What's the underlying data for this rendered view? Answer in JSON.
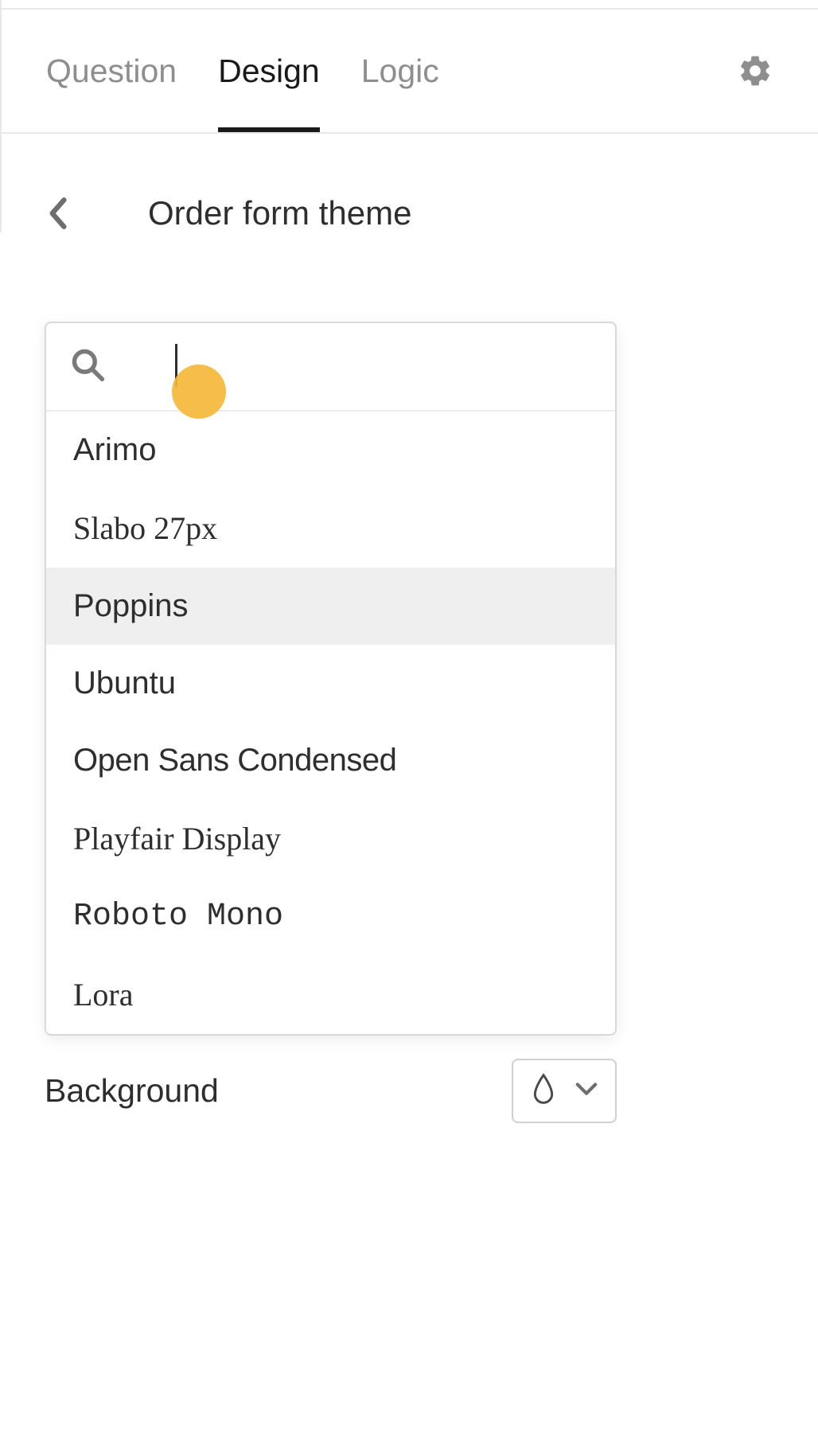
{
  "tabs": [
    {
      "label": "Question",
      "active": false
    },
    {
      "label": "Design",
      "active": true
    },
    {
      "label": "Logic",
      "active": false
    }
  ],
  "theme": {
    "title": "Order form theme"
  },
  "search": {
    "placeholder": ""
  },
  "fonts": [
    {
      "label": "Arimo",
      "class": "font-arimo",
      "selected": false
    },
    {
      "label": "Slabo 27px",
      "class": "font-slabo",
      "selected": false
    },
    {
      "label": "Poppins",
      "class": "font-poppins",
      "selected": true
    },
    {
      "label": "Ubuntu",
      "class": "font-ubuntu",
      "selected": false
    },
    {
      "label": "Open Sans Condensed",
      "class": "font-opensans",
      "selected": false
    },
    {
      "label": "Playfair Display",
      "class": "font-playfair",
      "selected": false
    },
    {
      "label": "Roboto Mono",
      "class": "font-roboto-mono",
      "selected": false
    },
    {
      "label": "Lora",
      "class": "font-lora",
      "selected": false
    }
  ],
  "background": {
    "label": "Background"
  }
}
